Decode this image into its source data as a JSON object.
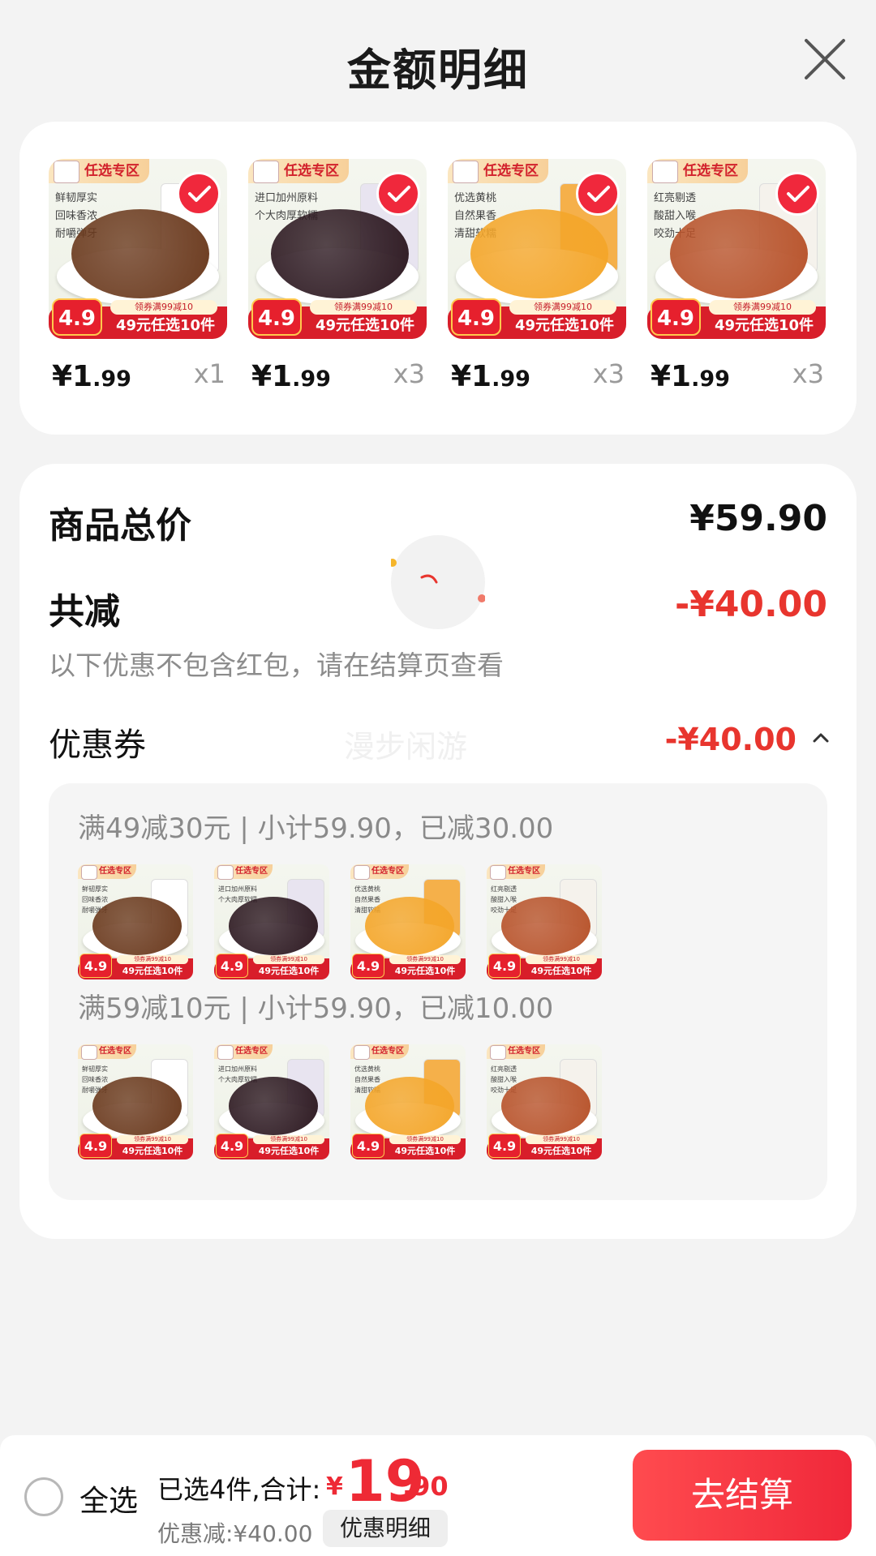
{
  "header": {
    "title": "金额明细"
  },
  "products": [
    {
      "price_int": "¥1",
      "price_dec": ".99",
      "qty": "x1",
      "tag": "任选专区",
      "features": [
        "鲜韧厚实",
        "回味香浓",
        "耐嚼弹牙"
      ],
      "promo_small": "领券满99减10",
      "promo_big": "49元任选10件",
      "badge_price": "4.9",
      "food_color": "#6b3a1e",
      "bag_color": "#ffffff"
    },
    {
      "price_int": "¥1",
      "price_dec": ".99",
      "qty": "x3",
      "tag": "任选专区",
      "features": [
        "进口加州原料",
        "个大肉厚软糯"
      ],
      "promo_small": "领券满99减10",
      "promo_big": "49元任选10件",
      "badge_price": "4.9",
      "food_color": "#2e1a22",
      "bag_color": "#e8e4f0"
    },
    {
      "price_int": "¥1",
      "price_dec": ".99",
      "qty": "x3",
      "tag": "任选专区",
      "features": [
        "优选黄桃",
        "自然果香",
        "清甜软糯"
      ],
      "promo_small": "领券满99减10",
      "promo_big": "49元任选10件",
      "badge_price": "4.9",
      "food_color": "#f4a62a",
      "bag_color": "#f5b04a"
    },
    {
      "price_int": "¥1",
      "price_dec": ".99",
      "qty": "x3",
      "tag": "任选专区",
      "features": [
        "红亮剔透",
        "酸甜入喉",
        "咬劲十足"
      ],
      "promo_small": "领券满99减10",
      "promo_big": "49元任选10件",
      "badge_price": "4.9",
      "food_color": "#b8532b",
      "bag_color": "#f5f2ec"
    }
  ],
  "summary": {
    "total_label": "商品总价",
    "total_value": "¥59.90",
    "discount_label": "共减",
    "discount_value": "-¥40.00",
    "discount_note": "以下优惠不包含红包，请在结算页查看",
    "coupon_label": "优惠券",
    "coupon_value": "-¥40.00",
    "watermark": "漫步闲游"
  },
  "coupon_groups": [
    {
      "title": "满49减30元 | 小计59.90，已减30.00"
    },
    {
      "title": "满59减10元 | 小计59.90，已减10.00"
    }
  ],
  "bottom_bar": {
    "select_all": "全选",
    "summary_text": "已选4件,合计:",
    "currency": "¥",
    "total_int": "19",
    "total_dec": ".90",
    "discount_text": "优惠减:¥40.00",
    "detail_button": "优惠明细",
    "checkout_button": "去结算"
  },
  "colors": {
    "accent_red": "#ee2a35",
    "discount_red": "#e8352e"
  }
}
